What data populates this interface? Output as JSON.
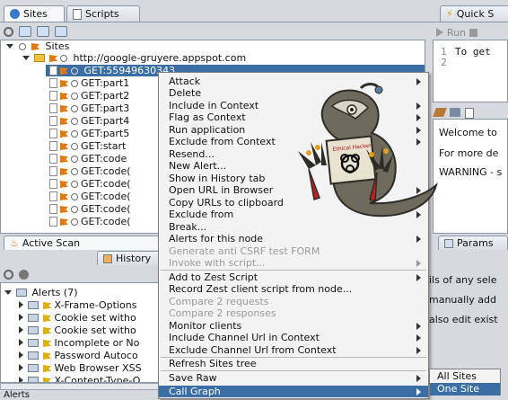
{
  "tabs": {
    "sites": "Sites",
    "scripts": "Scripts",
    "quick_start": "Quick S",
    "active_scan": "Active Scan",
    "history": "History",
    "params": "Params"
  },
  "sites_tree": {
    "root": "Sites",
    "host": "http://google-gruyere.appspot.com",
    "rows": [
      "GET:55949630343",
      "GET:part1",
      "GET:part2",
      "GET:part3",
      "GET:part4",
      "GET:part5",
      "GET:start",
      "GET:code",
      "GET:code(",
      "GET:code(",
      "GET:code(",
      "GET:code(",
      "GET:code("
    ]
  },
  "script_console": {
    "run_label": "Run",
    "line1_no": "1",
    "line2_no": "2",
    "line1_text": "To get"
  },
  "info_panel": {
    "line1": "Welcome to",
    "line2": "For more de",
    "line3": "WARNING - s"
  },
  "alerts_panel": {
    "root": "Alerts (7)",
    "items": [
      "X-Frame-Options",
      "Cookie set witho",
      "Cookie set witho",
      "Incomplete or No",
      "Password Autoco",
      "Web Browser XSS",
      "X-Content-Type-O"
    ],
    "status": "Alerts"
  },
  "right_texts": {
    "t1": "ils of any sele",
    "t2": "manually add",
    "t3": "also edit exist"
  },
  "context_menu": {
    "items": [
      {
        "label": "Attack",
        "sub": true,
        "disabled": false
      },
      {
        "label": "Delete",
        "sub": false,
        "disabled": false
      },
      {
        "label": "Include in Context",
        "sub": true,
        "disabled": false
      },
      {
        "label": "Flag as Context",
        "sub": true,
        "disabled": false
      },
      {
        "label": "Run application",
        "sub": true,
        "disabled": false
      },
      {
        "label": "Exclude from Context",
        "sub": true,
        "disabled": false
      },
      {
        "label": "Resend...",
        "sub": false,
        "disabled": false
      },
      {
        "label": "New Alert...",
        "sub": false,
        "disabled": false
      },
      {
        "label": "Show in History tab",
        "sub": false,
        "disabled": false
      },
      {
        "label": "Open URL in Browser",
        "sub": true,
        "disabled": false
      },
      {
        "label": "Copy URLs to clipboard",
        "sub": false,
        "disabled": false
      },
      {
        "label": "Exclude from",
        "sub": true,
        "disabled": false
      },
      {
        "label": "Break...",
        "sub": false,
        "disabled": false
      },
      {
        "label": "Alerts for this node",
        "sub": true,
        "disabled": false
      },
      {
        "label": "Generate anti CSRF test FORM",
        "sub": false,
        "disabled": true
      },
      {
        "label": "Invoke with script...",
        "sub": true,
        "disabled": true
      },
      {
        "label": "Add to Zest Script",
        "sub": true,
        "disabled": false
      },
      {
        "label": "Record Zest client script from node...",
        "sub": false,
        "disabled": false
      },
      {
        "label": "Compare 2 requests",
        "sub": false,
        "disabled": true
      },
      {
        "label": "Compare 2 responses",
        "sub": false,
        "disabled": true
      },
      {
        "label": "Monitor clients",
        "sub": true,
        "disabled": false
      },
      {
        "label": "Include Channel Url in Context",
        "sub": true,
        "disabled": false
      },
      {
        "label": "Exclude Channel Url from Context",
        "sub": true,
        "disabled": false
      },
      {
        "label": "Refresh Sites tree",
        "sub": false,
        "disabled": false
      },
      {
        "label": "Save Raw",
        "sub": true,
        "disabled": false
      },
      {
        "label": "Call Graph",
        "sub": true,
        "disabled": false,
        "highlighted": true
      }
    ]
  },
  "submenu": {
    "items": [
      {
        "label": "All Sites",
        "highlighted": false
      },
      {
        "label": "One Site",
        "highlighted": true
      }
    ]
  },
  "mascot_sign": "Ethical Hacker",
  "colors": {
    "selection": "#3a6ea5",
    "flag": "#e07a10"
  }
}
